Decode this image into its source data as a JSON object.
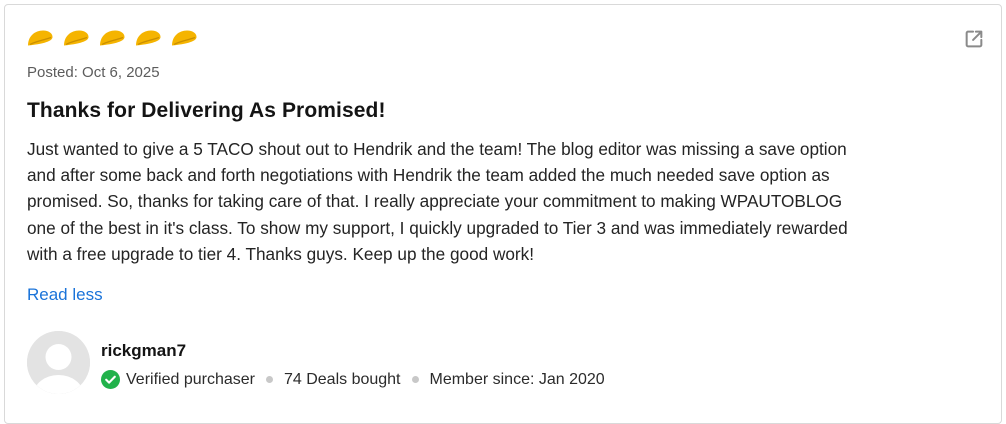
{
  "review": {
    "rating": 5,
    "rating_max": 5,
    "posted": "Posted: Oct 6, 2025",
    "title": "Thanks for Delivering As Promised!",
    "body": "Just wanted to give a 5 TACO shout out to Hendrik and the team! The blog editor was missing a save option\nand after some back and forth negotiations with Hendrik the team added the much needed save option as\npromised. So, thanks for taking care of that. I really appreciate your commitment to making WPAUTOBLOG\none of the best in it's class. To show my support, I quickly upgraded to Tier 3 and was immediately rewarded\nwith a free upgrade to tier 4. Thanks guys. Keep up the good work!",
    "read_less": "Read less"
  },
  "author": {
    "username": "rickgman7",
    "verified": "Verified purchaser",
    "deals": "74 Deals bought",
    "member_since": "Member since: Jan 2020"
  },
  "icons": {
    "rating": "taco-icon",
    "open": "external-link-icon",
    "verified": "check-circle-icon",
    "avatar": "user-avatar-placeholder"
  },
  "colors": {
    "taco": "#f5b400",
    "taco_shadow": "#c98f00",
    "link": "#1a73d9",
    "verified": "#21b24b",
    "icon_gray": "#8a8a8a"
  }
}
